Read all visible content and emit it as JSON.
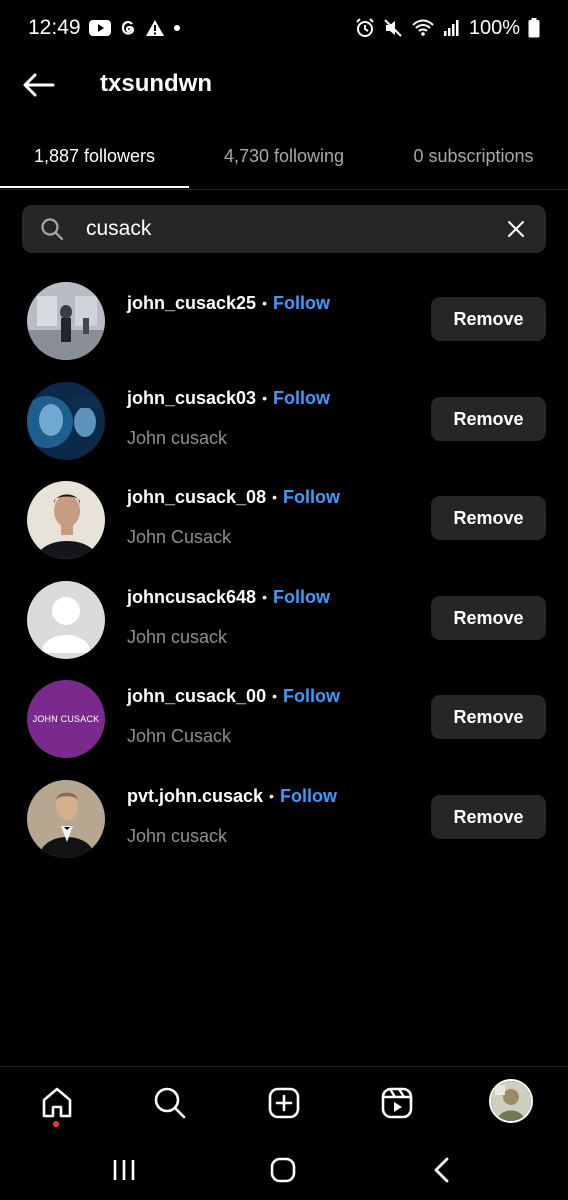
{
  "status_bar": {
    "time": "12:49",
    "battery": "100%",
    "left_icons": [
      "youtube-icon",
      "threads-icon",
      "warning-icon",
      "dot-icon"
    ],
    "right_icons": [
      "alarm-icon",
      "mute-icon",
      "wifi-icon",
      "signal-icon",
      "battery-icon"
    ]
  },
  "header": {
    "title": "txsundwn"
  },
  "tabs": [
    {
      "label": "1,887 followers",
      "active": true
    },
    {
      "label": "4,730 following",
      "active": false
    },
    {
      "label": "0 subscriptions",
      "active": false
    }
  ],
  "search": {
    "value": "cusack",
    "placeholder": "Search"
  },
  "followers": [
    {
      "username": "john_cusack25",
      "separator": "•",
      "follow_label": "Follow",
      "full_name": "",
      "remove_label": "Remove"
    },
    {
      "username": "john_cusack03",
      "separator": "•",
      "follow_label": "Follow",
      "full_name": "John cusack",
      "remove_label": "Remove"
    },
    {
      "username": "john_cusack_08",
      "separator": "•",
      "follow_label": "Follow",
      "full_name": "John Cusack",
      "remove_label": "Remove"
    },
    {
      "username": "johncusack648",
      "separator": "•",
      "follow_label": "Follow",
      "full_name": "John cusack",
      "remove_label": "Remove"
    },
    {
      "username": "john_cusack_00",
      "separator": "•",
      "follow_label": "Follow",
      "full_name": "John Cusack",
      "remove_label": "Remove",
      "avatar_text": "JOHN CUSACK"
    },
    {
      "username": "pvt.john.cusack",
      "separator": "•",
      "follow_label": "Follow",
      "full_name": "John cusack",
      "remove_label": "Remove"
    }
  ],
  "bottom_nav": [
    "home-icon",
    "search-icon",
    "create-icon",
    "reels-icon",
    "profile-avatar"
  ],
  "colors": {
    "background": "#000000",
    "surface": "#262626",
    "link_blue": "#3d9bff",
    "secondary_text": "#8e8e8e",
    "notification_red": "#ff3040",
    "purple_avatar": "#7a2a8c"
  }
}
